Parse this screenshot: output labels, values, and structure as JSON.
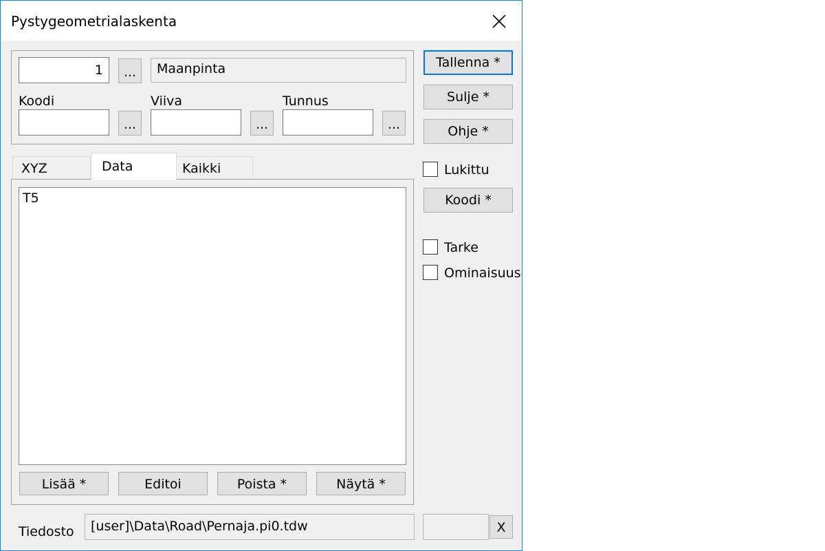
{
  "window": {
    "title": "Pystygeometrialaskenta",
    "close_glyph": "✕"
  },
  "top": {
    "number_value": "1",
    "ellipsis": "...",
    "name_value": "Maanpinta",
    "koodi_label": "Koodi",
    "viiva_label": "Viiva",
    "tunnus_label": "Tunnus",
    "koodi_value": "",
    "viiva_value": "",
    "tunnus_value": ""
  },
  "tabs": [
    {
      "label": "XYZ",
      "selected": false
    },
    {
      "label": "Data",
      "selected": true
    },
    {
      "label": "Kaikki",
      "selected": false
    }
  ],
  "data_list": {
    "items": [
      "T5"
    ]
  },
  "list_buttons": {
    "add": "Lisää *",
    "edit": "Editoi",
    "delete": "Poista *",
    "show": "Näytä *"
  },
  "side": {
    "save": "Tallenna *",
    "close": "Sulje *",
    "help": "Ohje *",
    "locked_label": "Lukittu",
    "locked_checked": false,
    "code": "Koodi *",
    "tarke_label": "Tarke",
    "tarke_checked": false,
    "ominaisuus_label": "Ominaisuus",
    "ominaisuus_checked": false
  },
  "file": {
    "label": "Tiedosto",
    "path": "[user]\\Data\\Road\\Pernaja.pi0.tdw",
    "extra_value": "",
    "clear": "X"
  },
  "colors": {
    "accent": "#0078d7",
    "window_border": "#1883d7",
    "face": "#f0f0f0"
  }
}
